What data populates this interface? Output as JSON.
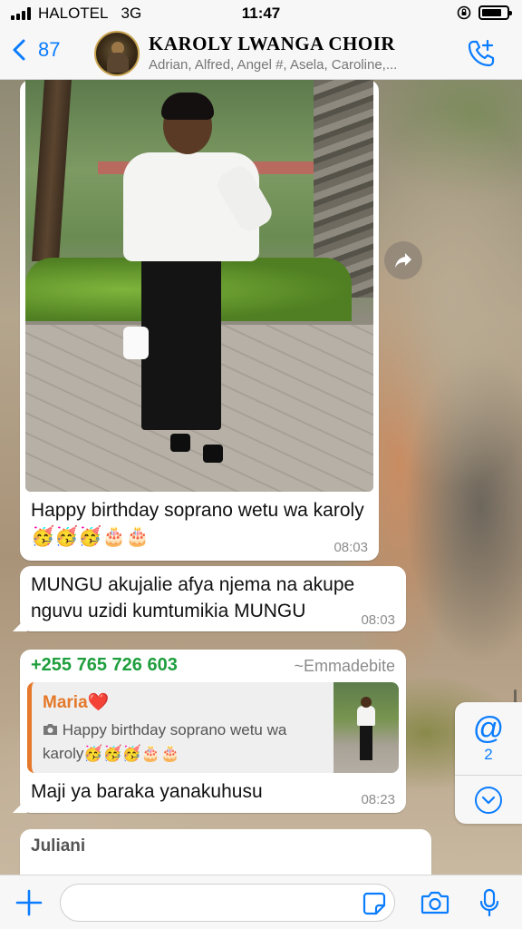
{
  "status_bar": {
    "carrier": "HALOTEL",
    "network": "3G",
    "time": "11:47",
    "battery_level": 0.8
  },
  "header": {
    "back_count": "87",
    "group_name": "KAROLY LWANGA CHOIR",
    "members": "Adrian, Alfred, Angel #, Asela, Caroline,..."
  },
  "messages": [
    {
      "type": "photo",
      "caption": "Happy birthday soprano wetu wa karoly🥳🥳🥳🎂🎂",
      "time": "08:03"
    },
    {
      "type": "text",
      "text": "MUNGU akujalie afya njema na akupe nguvu uzidi kumtumikia MUNGU",
      "time": "08:03"
    },
    {
      "type": "reply",
      "sender_phone": "+255 765 726 603",
      "sender_alias": "~Emmadebite",
      "quote_author": "Maria❤️",
      "quote_text": "Happy birthday soprano wetu wa karoly🥳🥳🥳🎂🎂",
      "text": "Maji ya baraka yanakuhusu",
      "time": "08:23"
    },
    {
      "type": "partial",
      "sender_name": "Juliani"
    }
  ],
  "mentions": {
    "symbol": "@",
    "count": "2"
  },
  "composer": {
    "placeholder": ""
  },
  "colors": {
    "accent": "#0a7cff",
    "sender_green": "#1f9e3d",
    "quote_orange": "#e5782a"
  }
}
